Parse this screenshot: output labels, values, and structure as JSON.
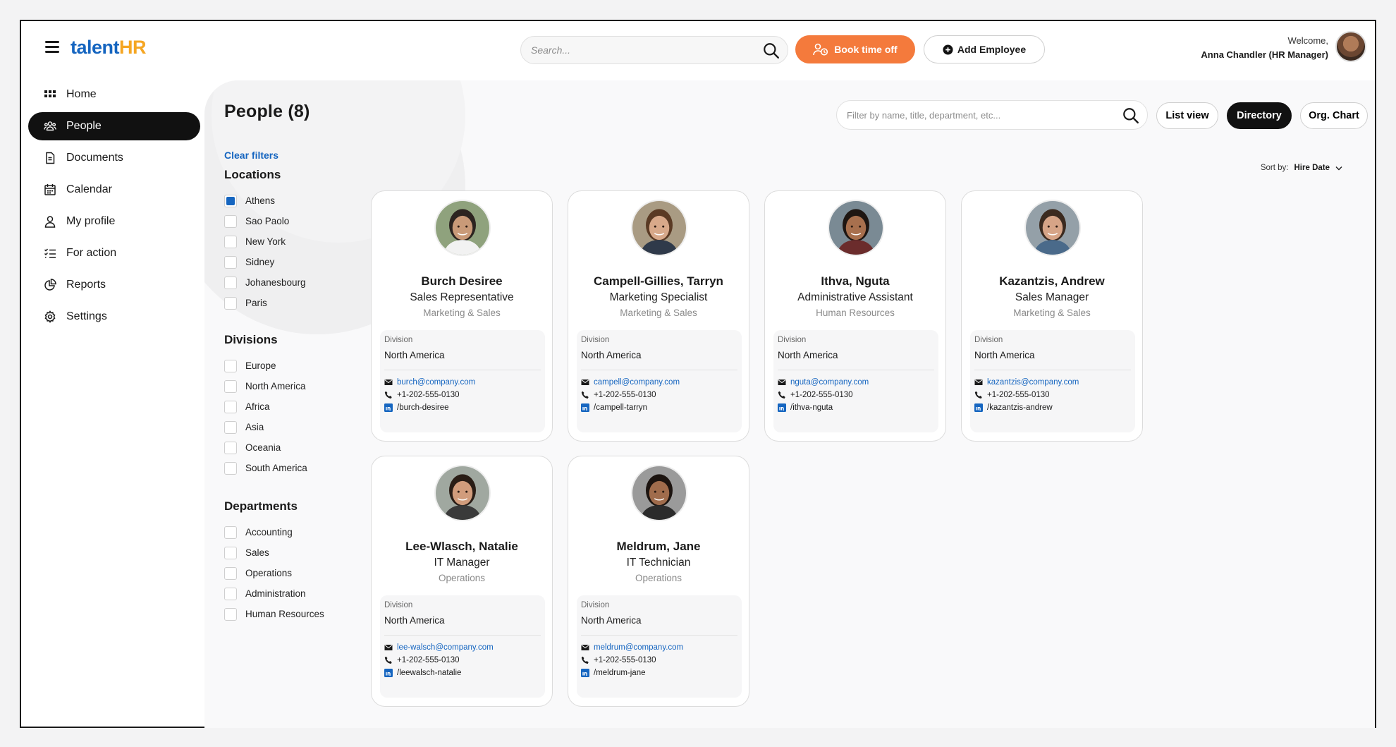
{
  "app": {
    "logo_part1": "talent",
    "logo_part2": "HR"
  },
  "header": {
    "search_placeholder": "Search...",
    "book_time_off": "Book time off",
    "add_employee": "Add Employee",
    "welcome": "Welcome,",
    "user": "Anna Chandler (HR Manager)"
  },
  "sidebar": {
    "items": [
      {
        "label": "Home",
        "icon": "grid-icon"
      },
      {
        "label": "People",
        "icon": "people-icon",
        "active": true
      },
      {
        "label": "Documents",
        "icon": "document-icon"
      },
      {
        "label": "Calendar",
        "icon": "calendar-icon"
      },
      {
        "label": "My profile",
        "icon": "user-icon"
      },
      {
        "label": "For action",
        "icon": "checklist-icon"
      },
      {
        "label": "Reports",
        "icon": "pie-chart-icon"
      },
      {
        "label": "Settings",
        "icon": "gear-icon"
      }
    ]
  },
  "main": {
    "page_title": "People (8)",
    "clear_filters": "Clear filters",
    "filter_placeholder": "Filter by name, title, department, etc...",
    "views": [
      "List view",
      "Directory",
      "Org. Chart"
    ],
    "active_view": "Directory",
    "sort_label": "Sort by:",
    "sort_value": "Hire Date"
  },
  "filters": {
    "locations": {
      "title": "Locations",
      "items": [
        {
          "label": "Athens",
          "checked": true
        },
        {
          "label": "Sao Paolo",
          "checked": false
        },
        {
          "label": "New York",
          "checked": false
        },
        {
          "label": "Sidney",
          "checked": false
        },
        {
          "label": "Johanesbourg",
          "checked": false
        },
        {
          "label": "Paris",
          "checked": false
        }
      ]
    },
    "divisions": {
      "title": "Divisions",
      "items": [
        {
          "label": "Europe",
          "checked": false
        },
        {
          "label": "North America",
          "checked": false
        },
        {
          "label": "Africa",
          "checked": false
        },
        {
          "label": "Asia",
          "checked": false
        },
        {
          "label": "Oceania",
          "checked": false
        },
        {
          "label": "South America",
          "checked": false
        }
      ]
    },
    "departments": {
      "title": "Departments",
      "items": [
        {
          "label": "Accounting",
          "checked": false
        },
        {
          "label": "Sales",
          "checked": false
        },
        {
          "label": "Operations",
          "checked": false
        },
        {
          "label": "Administration",
          "checked": false
        },
        {
          "label": "Human Resources",
          "checked": false
        }
      ]
    }
  },
  "people": [
    {
      "name": "Burch Desiree",
      "title": "Sales Representative",
      "department": "Marketing & Sales",
      "division_label": "Division",
      "division": "North America",
      "email": "burch@company.com",
      "phone": "+1-202-555-0130",
      "linkedin": "/burch-desiree",
      "skin": "#c99a78",
      "hair": "#2c2420"
    },
    {
      "name": "Campell-Gillies, Tarryn",
      "title": "Marketing Specialist",
      "department": "Marketing & Sales",
      "division_label": "Division",
      "division": "North America",
      "email": "campell@company.com",
      "phone": "+1-202-555-0130",
      "linkedin": "/campell-tarryn",
      "skin": "#d8a98a",
      "hair": "#5a3a24"
    },
    {
      "name": "Ithva, Nguta",
      "title": "Administrative Assistant",
      "department": "Human Resources",
      "division_label": "Division",
      "division": "North America",
      "email": "nguta@company.com",
      "phone": "+1-202-555-0130",
      "linkedin": "/ithva-nguta",
      "skin": "#a8704e",
      "hair": "#1e1612"
    },
    {
      "name": "Kazantzis, Andrew",
      "title": "Sales Manager",
      "department": "Marketing & Sales",
      "division_label": "Division",
      "division": "North America",
      "email": "kazantzis@company.com",
      "phone": "+1-202-555-0130",
      "linkedin": "/kazantzis-andrew",
      "skin": "#d6a487",
      "hair": "#3b2a1f"
    },
    {
      "name": "Lee-Wlasch, Natalie",
      "title": "IT Manager",
      "department": "Operations",
      "division_label": "Division",
      "division": "North America",
      "email": "lee-walsch@company.com",
      "phone": "+1-202-555-0130",
      "linkedin": "/leewalsch-natalie",
      "skin": "#d19c7c",
      "hair": "#2a1d16"
    },
    {
      "name": "Meldrum, Jane",
      "title": "IT Technician",
      "department": "Operations",
      "division_label": "Division",
      "division": "North America",
      "email": "meldrum@company.com",
      "phone": "+1-202-555-0130",
      "linkedin": "/meldrum-jane",
      "skin": "#a06c4c",
      "hair": "#1c1410"
    }
  ],
  "colors": {
    "accent_blue": "#1565c0",
    "accent_orange": "#f47a3c",
    "logo_orange": "#f5a623",
    "active_nav": "#111111"
  }
}
